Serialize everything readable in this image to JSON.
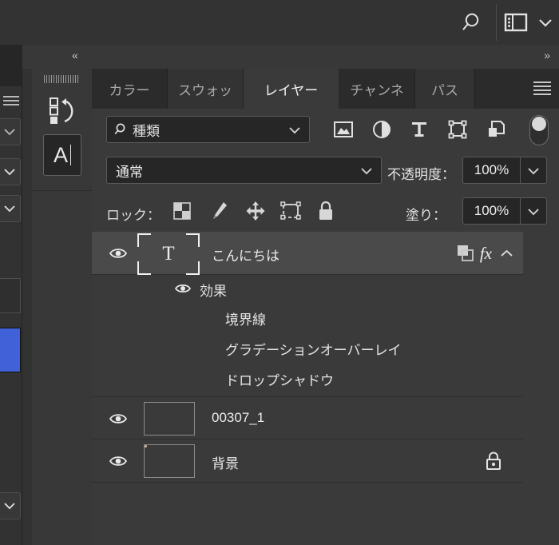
{
  "topbar": {
    "search_icon": "search-icon",
    "workspace_icon": "workspace-switcher-icon",
    "chevron_icon": "chevron-down-icon"
  },
  "dock_strip": {
    "collapse_left": "«",
    "collapse_right": "»"
  },
  "tool_dock": {
    "history_icon": "history-actions-icon",
    "type_tool_label": "A",
    "type_tool_icon": "type-tool-icon"
  },
  "panel": {
    "tabs": [
      {
        "label": "カラー",
        "active": false
      },
      {
        "label": "スウォッ",
        "active": false
      },
      {
        "label": "レイヤー",
        "active": true
      },
      {
        "label": "チャンネ",
        "active": false
      },
      {
        "label": "パス",
        "active": false
      }
    ],
    "menu_icon": "panel-menu-icon"
  },
  "filter": {
    "kind_value": "種類",
    "search_icon": "search-icon",
    "chevron_icon": "chevron-down-icon",
    "buttons": [
      {
        "name": "filter-pixel-icon"
      },
      {
        "name": "filter-adjustment-icon"
      },
      {
        "name": "filter-type-icon"
      },
      {
        "name": "filter-shape-icon"
      },
      {
        "name": "filter-smartobject-icon"
      }
    ],
    "toggle_name": "filter-enable-toggle"
  },
  "blend": {
    "mode_value": "通常",
    "opacity_label": "不透明度：",
    "opacity_value": "100%"
  },
  "lock": {
    "label": "ロック：",
    "buttons": [
      {
        "name": "lock-transparent-pixels-icon"
      },
      {
        "name": "lock-image-pixels-icon"
      },
      {
        "name": "lock-position-icon"
      },
      {
        "name": "lock-artboard-nesting-icon"
      },
      {
        "name": "lock-all-icon"
      }
    ],
    "fill_label": "塗り：",
    "fill_value": "100%"
  },
  "layers": [
    {
      "name": "こんにちは",
      "type": "text",
      "selected": true,
      "visible": true,
      "badges": [
        "layer-link-icon",
        "fx",
        "chevron-up-icon"
      ],
      "fx_label": "fx"
    },
    {
      "name": "00307_1",
      "type": "smart-object",
      "selected": false,
      "visible": true,
      "badges": []
    },
    {
      "name": "背景",
      "type": "background",
      "selected": false,
      "visible": true,
      "badges": [
        "lock-icon"
      ]
    }
  ],
  "effects": {
    "header": "効果",
    "items": [
      "境界線",
      "グラデーションオーバーレイ",
      "ドロップシャドウ"
    ]
  },
  "colors": {
    "panel_bg": "#3a3a3a",
    "panel_dark": "#2b2b2b",
    "selected_row": "#4a4a4a",
    "field_bg": "#262626",
    "swatch_blue": "#4061d8",
    "text": "#ececec"
  }
}
